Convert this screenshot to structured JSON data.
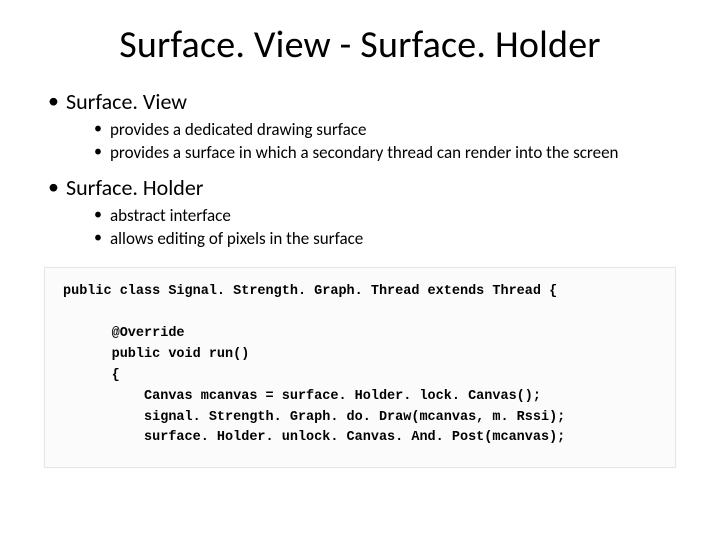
{
  "title": "Surface. View - Surface. Holder",
  "sections": [
    {
      "heading": "Surface. View",
      "items": [
        "provides a dedicated drawing surface",
        "provides a surface in which a secondary thread can render into the screen"
      ]
    },
    {
      "heading": "Surface. Holder",
      "items": [
        "abstract interface",
        "allows editing of pixels in the surface"
      ]
    }
  ],
  "code": "public class Signal. Strength. Graph. Thread extends Thread {\n\n      @Override\n      public void run()\n      {\n          Canvas mcanvas = surface. Holder. lock. Canvas();\n          signal. Strength. Graph. do. Draw(mcanvas, m. Rssi);\n          surface. Holder. unlock. Canvas. And. Post(mcanvas);"
}
